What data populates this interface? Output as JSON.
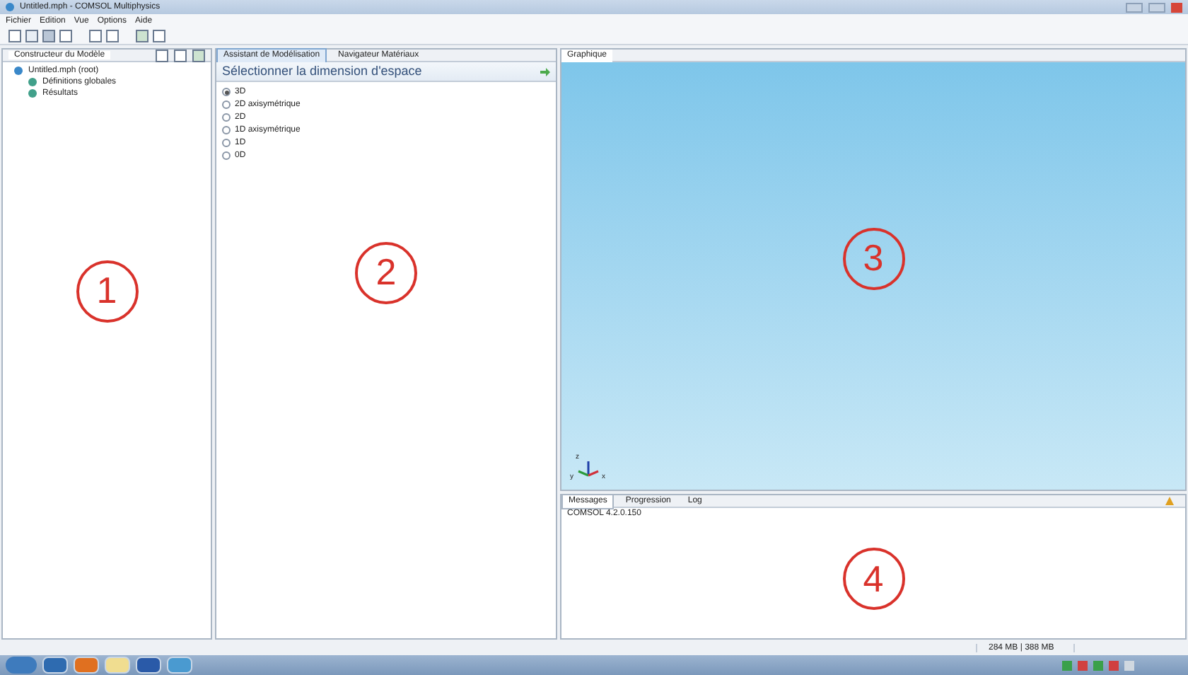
{
  "window": {
    "title": "Untitled.mph - COMSOL Multiphysics"
  },
  "menu": [
    "Fichier",
    "Edition",
    "Vue",
    "Options",
    "Aide"
  ],
  "model_builder": {
    "tab": "Constructeur du Modèle",
    "tree": [
      {
        "label": "Untitled.mph (root)",
        "children": [
          {
            "label": "Définitions globales"
          },
          {
            "label": "Résultats"
          }
        ]
      }
    ]
  },
  "wizard": {
    "tabs": [
      {
        "label": "Assistant de Modélisation",
        "selected": true
      },
      {
        "label": "Navigateur Matériaux",
        "selected": false
      }
    ],
    "heading": "Sélectionner la dimension d'espace",
    "options": [
      {
        "label": "3D",
        "selected": true
      },
      {
        "label": "2D axisymétrique",
        "selected": false
      },
      {
        "label": "2D",
        "selected": false
      },
      {
        "label": "1D axisymétrique",
        "selected": false
      },
      {
        "label": "1D",
        "selected": false
      },
      {
        "label": "0D",
        "selected": false
      }
    ]
  },
  "graphics": {
    "tab": "Graphique",
    "axes": [
      "z",
      "y",
      "x"
    ]
  },
  "messages": {
    "tabs": [
      {
        "label": "Messages",
        "selected": true
      },
      {
        "label": "Progression",
        "selected": false
      },
      {
        "label": "Log",
        "selected": false
      }
    ],
    "lines": [
      "COMSOL 4.2.0.150"
    ]
  },
  "status_bar": {
    "memory": "284 MB | 388 MB"
  },
  "annotations": [
    "1",
    "2",
    "3",
    "4"
  ]
}
